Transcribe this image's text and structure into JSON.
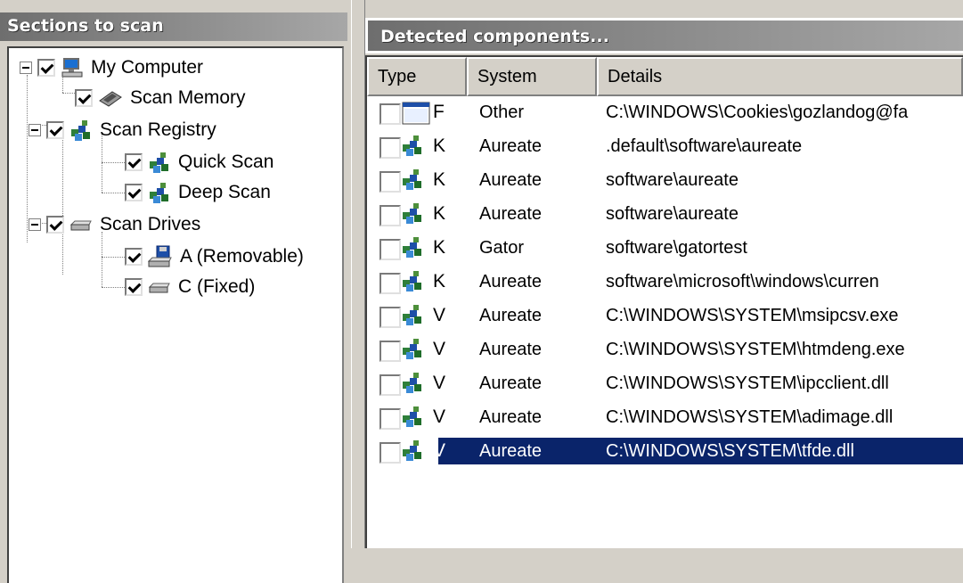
{
  "left_panel": {
    "header": "Sections to scan",
    "tree": [
      {
        "label": "My Computer",
        "icon": "computer-icon",
        "checked": true
      },
      {
        "label": "Scan Memory",
        "icon": "memory-chip-icon",
        "checked": true
      },
      {
        "label": "Scan Registry",
        "icon": "registry-cubes-icon",
        "checked": true
      },
      {
        "label": "Quick Scan",
        "icon": "registry-cubes-icon",
        "checked": true
      },
      {
        "label": "Deep Scan",
        "icon": "registry-cubes-icon",
        "checked": true
      },
      {
        "label": "Scan Drives",
        "icon": "drive-icon",
        "checked": true
      },
      {
        "label": "A (Removable)",
        "icon": "floppy-drive-icon",
        "checked": true
      },
      {
        "label": "C (Fixed)",
        "icon": "hard-drive-icon",
        "checked": true
      }
    ]
  },
  "right_panel": {
    "header": "Detected components...",
    "columns": [
      "Type",
      "System",
      "Details"
    ],
    "rows": [
      {
        "type": "F",
        "icon": "window-file-icon",
        "system": "Other",
        "details": "C:\\WINDOWS\\Cookies\\gozlandog@fa",
        "selected": false
      },
      {
        "type": "K",
        "icon": "registry-cubes-icon",
        "system": "Aureate",
        "details": ".default\\software\\aureate",
        "selected": false
      },
      {
        "type": "K",
        "icon": "registry-cubes-icon",
        "system": "Aureate",
        "details": "software\\aureate",
        "selected": false
      },
      {
        "type": "K",
        "icon": "registry-cubes-icon",
        "system": "Aureate",
        "details": "software\\aureate",
        "selected": false
      },
      {
        "type": "K",
        "icon": "registry-cubes-icon",
        "system": "Gator",
        "details": "software\\gatortest",
        "selected": false
      },
      {
        "type": "K",
        "icon": "registry-cubes-icon",
        "system": "Aureate",
        "details": "software\\microsoft\\windows\\curren",
        "selected": false
      },
      {
        "type": "V",
        "icon": "registry-cubes-icon",
        "system": "Aureate",
        "details": "C:\\WINDOWS\\SYSTEM\\msipcsv.exe",
        "selected": false
      },
      {
        "type": "V",
        "icon": "registry-cubes-icon",
        "system": "Aureate",
        "details": "C:\\WINDOWS\\SYSTEM\\htmdeng.exe",
        "selected": false
      },
      {
        "type": "V",
        "icon": "registry-cubes-icon",
        "system": "Aureate",
        "details": "C:\\WINDOWS\\SYSTEM\\ipcclient.dll",
        "selected": false
      },
      {
        "type": "V",
        "icon": "registry-cubes-icon",
        "system": "Aureate",
        "details": "C:\\WINDOWS\\SYSTEM\\adimage.dll",
        "selected": false
      },
      {
        "type": "V",
        "icon": "registry-cubes-icon",
        "system": "Aureate",
        "details": "C:\\WINDOWS\\SYSTEM\\tfde.dll",
        "selected": true
      }
    ]
  },
  "colors": {
    "selection": "#0a246a",
    "face": "#d4d0c8",
    "header_gradient_start": "#6e6e6e",
    "header_gradient_end": "#a7a7a7"
  }
}
